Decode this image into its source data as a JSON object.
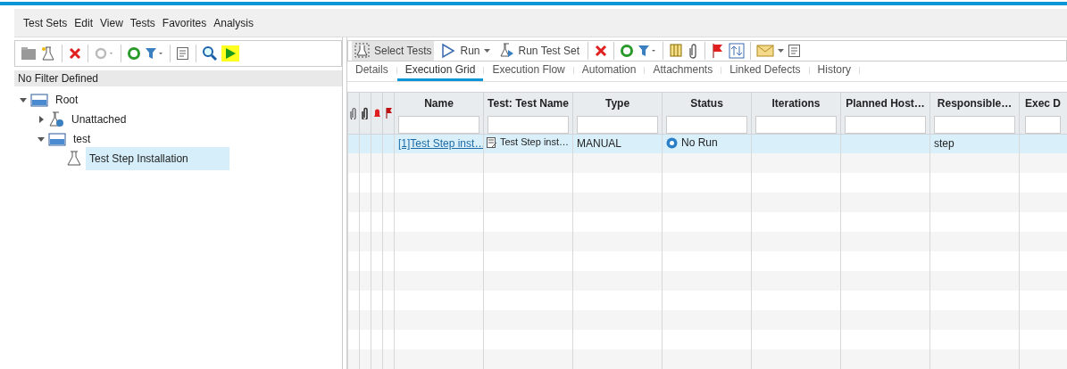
{
  "menu": [
    "Test Sets",
    "Edit",
    "View",
    "Tests",
    "Favorites",
    "Analysis"
  ],
  "left_panel": {
    "filter_label": "No Filter Defined",
    "tree": [
      {
        "label": "Root",
        "kind": "folder",
        "expanded": true,
        "selected": false,
        "children": [
          {
            "label": "Unattached",
            "kind": "unattached",
            "expanded": false,
            "selected": false
          },
          {
            "label": "test",
            "kind": "folder",
            "expanded": true,
            "selected": false,
            "children": [
              {
                "label": "Test Step Installation",
                "kind": "test",
                "selected": true
              }
            ]
          }
        ]
      }
    ]
  },
  "right_toolbar": [
    {
      "label": "Select Tests",
      "kind": "select",
      "pressed": true
    },
    {
      "label": "Run",
      "kind": "run",
      "pressed": false
    },
    {
      "label": "Run Test Set",
      "kind": "runset",
      "pressed": false
    }
  ],
  "tabs": [
    {
      "label": "Details",
      "selected": false
    },
    {
      "label": "Execution Grid",
      "selected": true
    },
    {
      "label": "Execution Flow",
      "selected": false
    },
    {
      "label": "Automation",
      "selected": false
    },
    {
      "label": "Attachments",
      "selected": false
    },
    {
      "label": "Linked Defects",
      "selected": false
    },
    {
      "label": "History",
      "selected": false
    }
  ],
  "grid": {
    "columns": [
      "Name",
      "Test: Test Name",
      "Type",
      "Status",
      "Iterations",
      "Planned Host…",
      "Responsible…",
      "Exec D"
    ],
    "rows": [
      {
        "selected": true,
        "name": "[1]Test Step inst…",
        "test_name": "Test Step inst…",
        "type": "MANUAL",
        "status": "No Run",
        "responsible": "step"
      }
    ]
  }
}
